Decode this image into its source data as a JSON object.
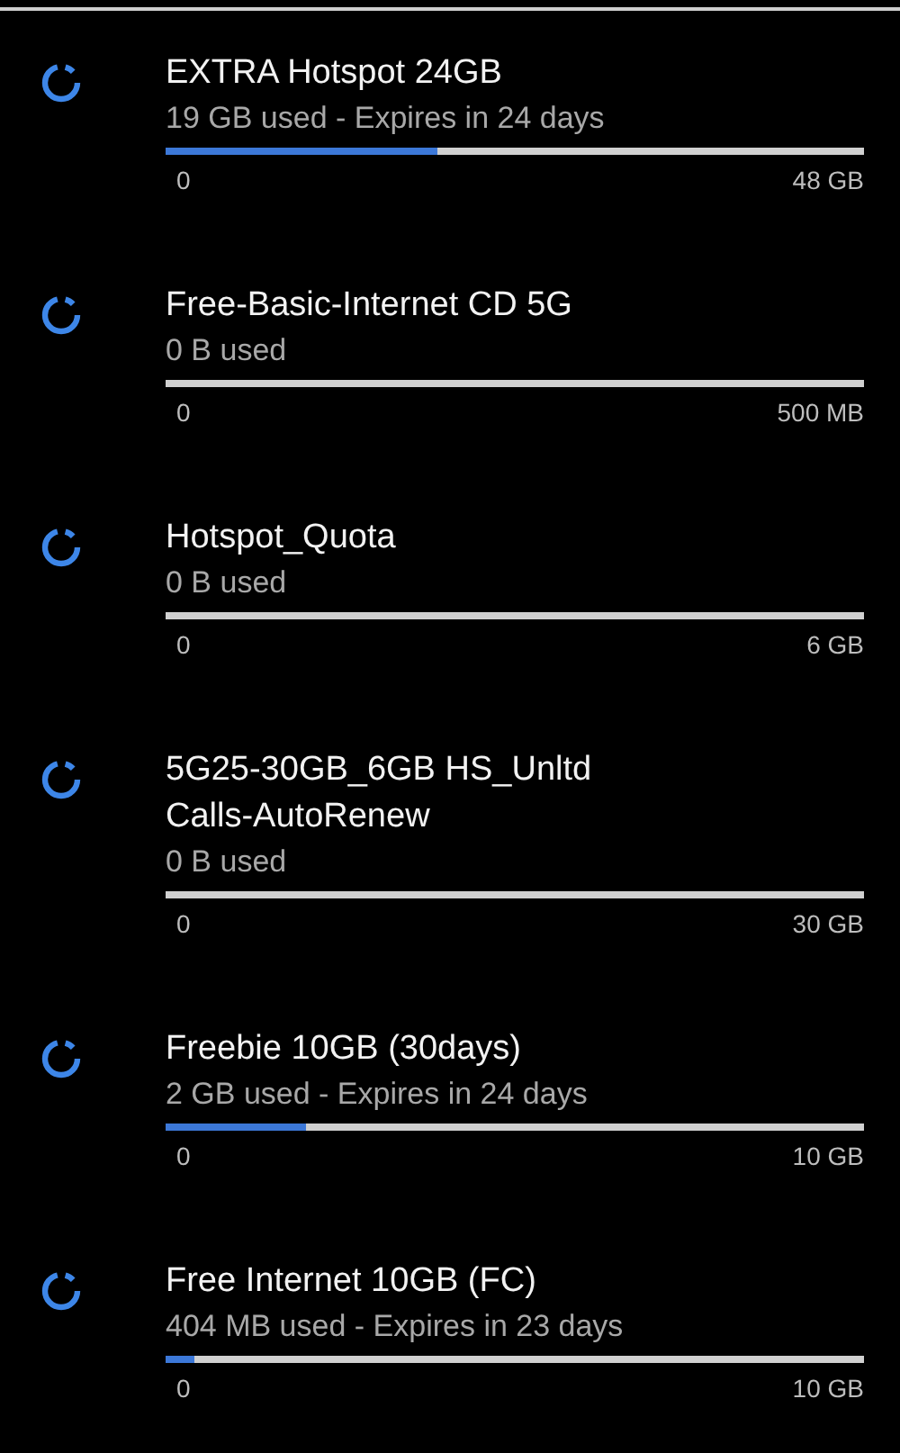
{
  "plans": [
    {
      "title": "EXTRA Hotspot 24GB",
      "usage": "19 GB used - Expires in 24 days",
      "level": 0.39,
      "min": "0",
      "max": "48 GB"
    },
    {
      "title": "Free-Basic-Internet CD 5G",
      "usage": "0 B used",
      "level": 0,
      "min": "0",
      "max": "500 MB"
    },
    {
      "title": "Hotspot_Quota",
      "usage": "0 B used",
      "level": 0,
      "min": "0",
      "max": "6 GB"
    },
    {
      "title": "5G25-30GB_6GB HS_Unltd Calls-AutoRenew",
      "usage": "0 B used",
      "level": 0,
      "min": "0",
      "max": "30 GB"
    },
    {
      "title": "Freebie 10GB (30days)",
      "usage": "2 GB used - Expires in 24 days",
      "level": 0.2,
      "min": "0",
      "max": "10 GB"
    },
    {
      "title": "Free Internet 10GB (FC)",
      "usage": "404 MB used - Expires in 23 days",
      "level": 0.04,
      "min": "0",
      "max": "10 GB"
    }
  ]
}
